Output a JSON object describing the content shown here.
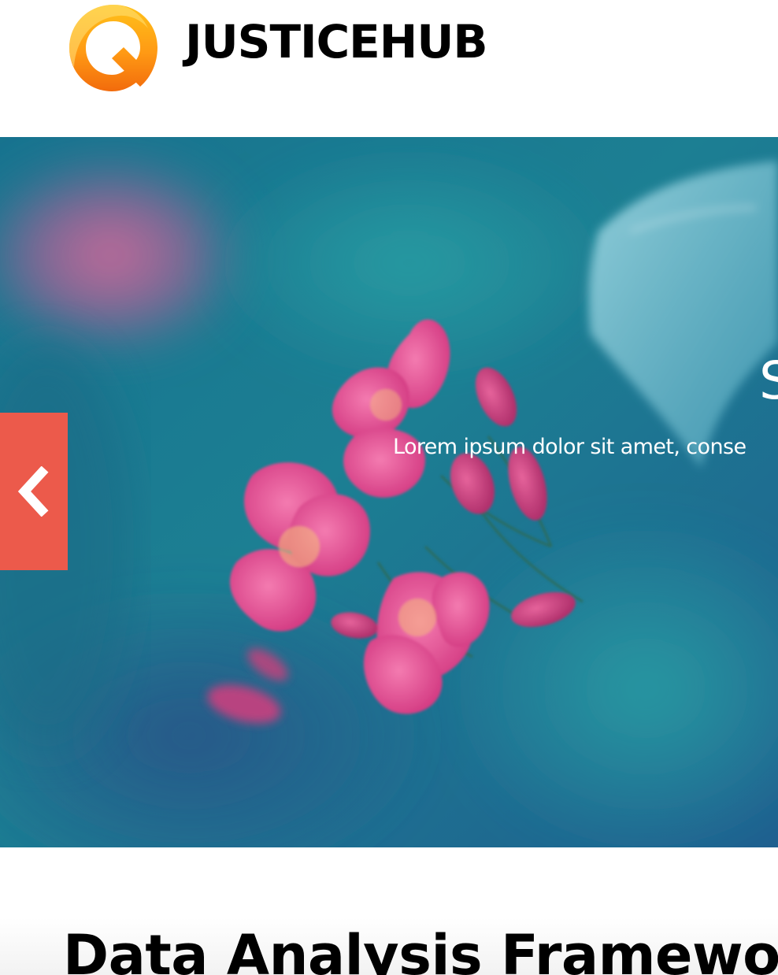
{
  "header": {
    "site_name": "JUSTICEHUB",
    "logo_icon": "justicehub-logo-icon"
  },
  "hero": {
    "title": "S",
    "subtitle": "Lorem ipsum dolor sit amet, conse",
    "prev_icon": "chevron-left-icon",
    "colors": {
      "prev_button": "#ec5a4b"
    }
  },
  "content": {
    "heading": "Data Analysis Framework:"
  }
}
